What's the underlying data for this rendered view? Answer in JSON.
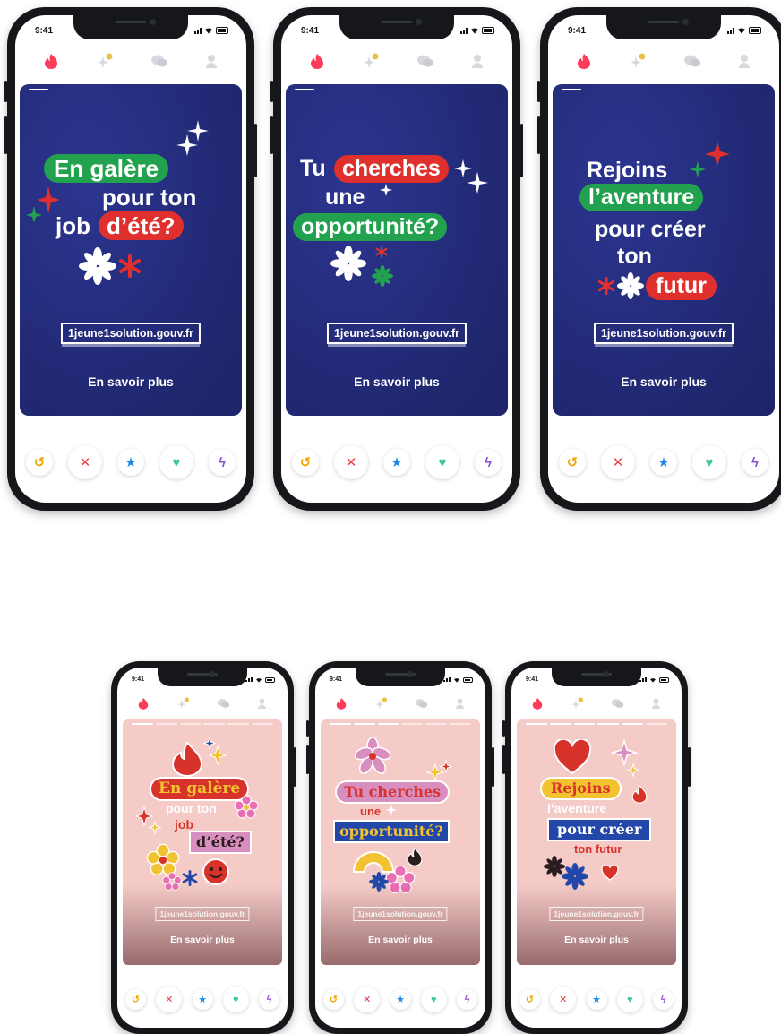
{
  "status": {
    "time": "9:41"
  },
  "icons": {
    "nav": [
      "flame-icon",
      "sparkle-icon",
      "chat-icon",
      "profile-icon"
    ],
    "actions": [
      "rewind-icon",
      "nope-icon",
      "superlike-icon",
      "like-icon",
      "boost-icon"
    ]
  },
  "colors": {
    "navy_card": "#232b78",
    "green_pill": "#22a24f",
    "red_pill": "#e0302e",
    "pink_card": "#f5cbc8",
    "tinder_red": "#fd3b5a",
    "rewind": "#f0a500",
    "nope": "#ee3b48",
    "superlike": "#1e88e5",
    "like": "#3ec6a0",
    "boost": "#8b4fd8"
  },
  "cards": [
    {
      "lines": [
        "En galère",
        "pour ton",
        "job",
        "d’été?"
      ]
    },
    {
      "lines": [
        "Tu",
        "cherches",
        "une",
        "opportunité?"
      ]
    },
    {
      "lines": [
        "Rejoins",
        "l’aventure",
        "pour créer",
        "ton",
        "futur"
      ]
    },
    {
      "lines": [
        "En galère",
        "pour ton",
        "job",
        "d’été?"
      ]
    },
    {
      "lines": [
        "Tu cherches",
        "une",
        "opportunité?"
      ]
    },
    {
      "lines": [
        "Rejoins",
        "l’aventure",
        "pour créer",
        "ton futur"
      ]
    }
  ],
  "url": "1jeune1solution.gouv.fr",
  "cta": "En savoir plus"
}
